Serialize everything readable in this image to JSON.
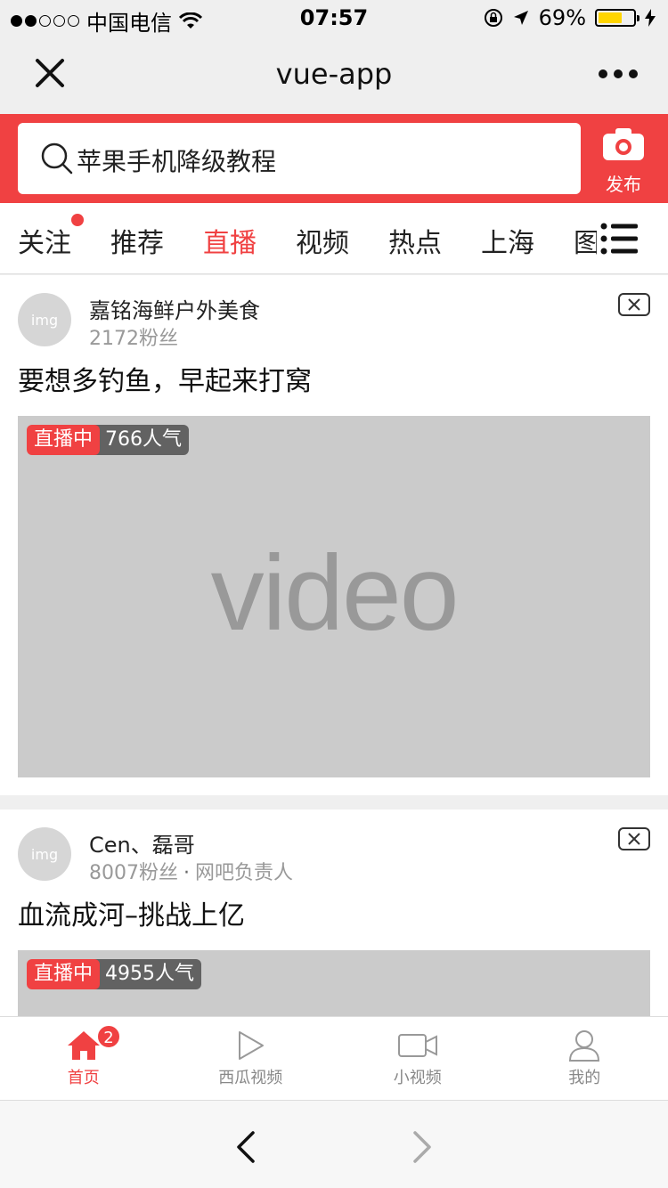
{
  "status_bar": {
    "carrier": "中国电信",
    "time": "07:57",
    "battery": "69%",
    "battery_level": 0.69
  },
  "navbar": {
    "title": "vue-app"
  },
  "search": {
    "query": "苹果手机降级教程",
    "publish_label": "发布"
  },
  "channels": [
    {
      "label": "关注",
      "has_dot": true
    },
    {
      "label": "推荐"
    },
    {
      "label": "直播",
      "active": true
    },
    {
      "label": "视频"
    },
    {
      "label": "热点"
    },
    {
      "label": "上海"
    },
    {
      "label": "图"
    }
  ],
  "feed": [
    {
      "avatar_text": "img",
      "author": "嘉铭海鲜户外美食",
      "followers": "2172粉丝",
      "title": "要想多钓鱼，早起来打窝",
      "live_label": "直播中",
      "popularity": "766人气",
      "video_placeholder": "video"
    },
    {
      "avatar_text": "img",
      "author": "Cen、磊哥",
      "followers": "8007粉丝",
      "separator": "·",
      "role": "网吧负责人",
      "title": "血流成河–挑战上亿",
      "live_label": "直播中",
      "popularity": "4955人气"
    }
  ],
  "tabbar": [
    {
      "label": "首页",
      "icon": "home-icon",
      "badge": "2",
      "active": true
    },
    {
      "label": "西瓜视频",
      "icon": "play-icon"
    },
    {
      "label": "小视频",
      "icon": "video-camera-icon"
    },
    {
      "label": "我的",
      "icon": "user-icon"
    }
  ],
  "colors": {
    "accent": "#f04142",
    "battery": "#ffd500"
  }
}
